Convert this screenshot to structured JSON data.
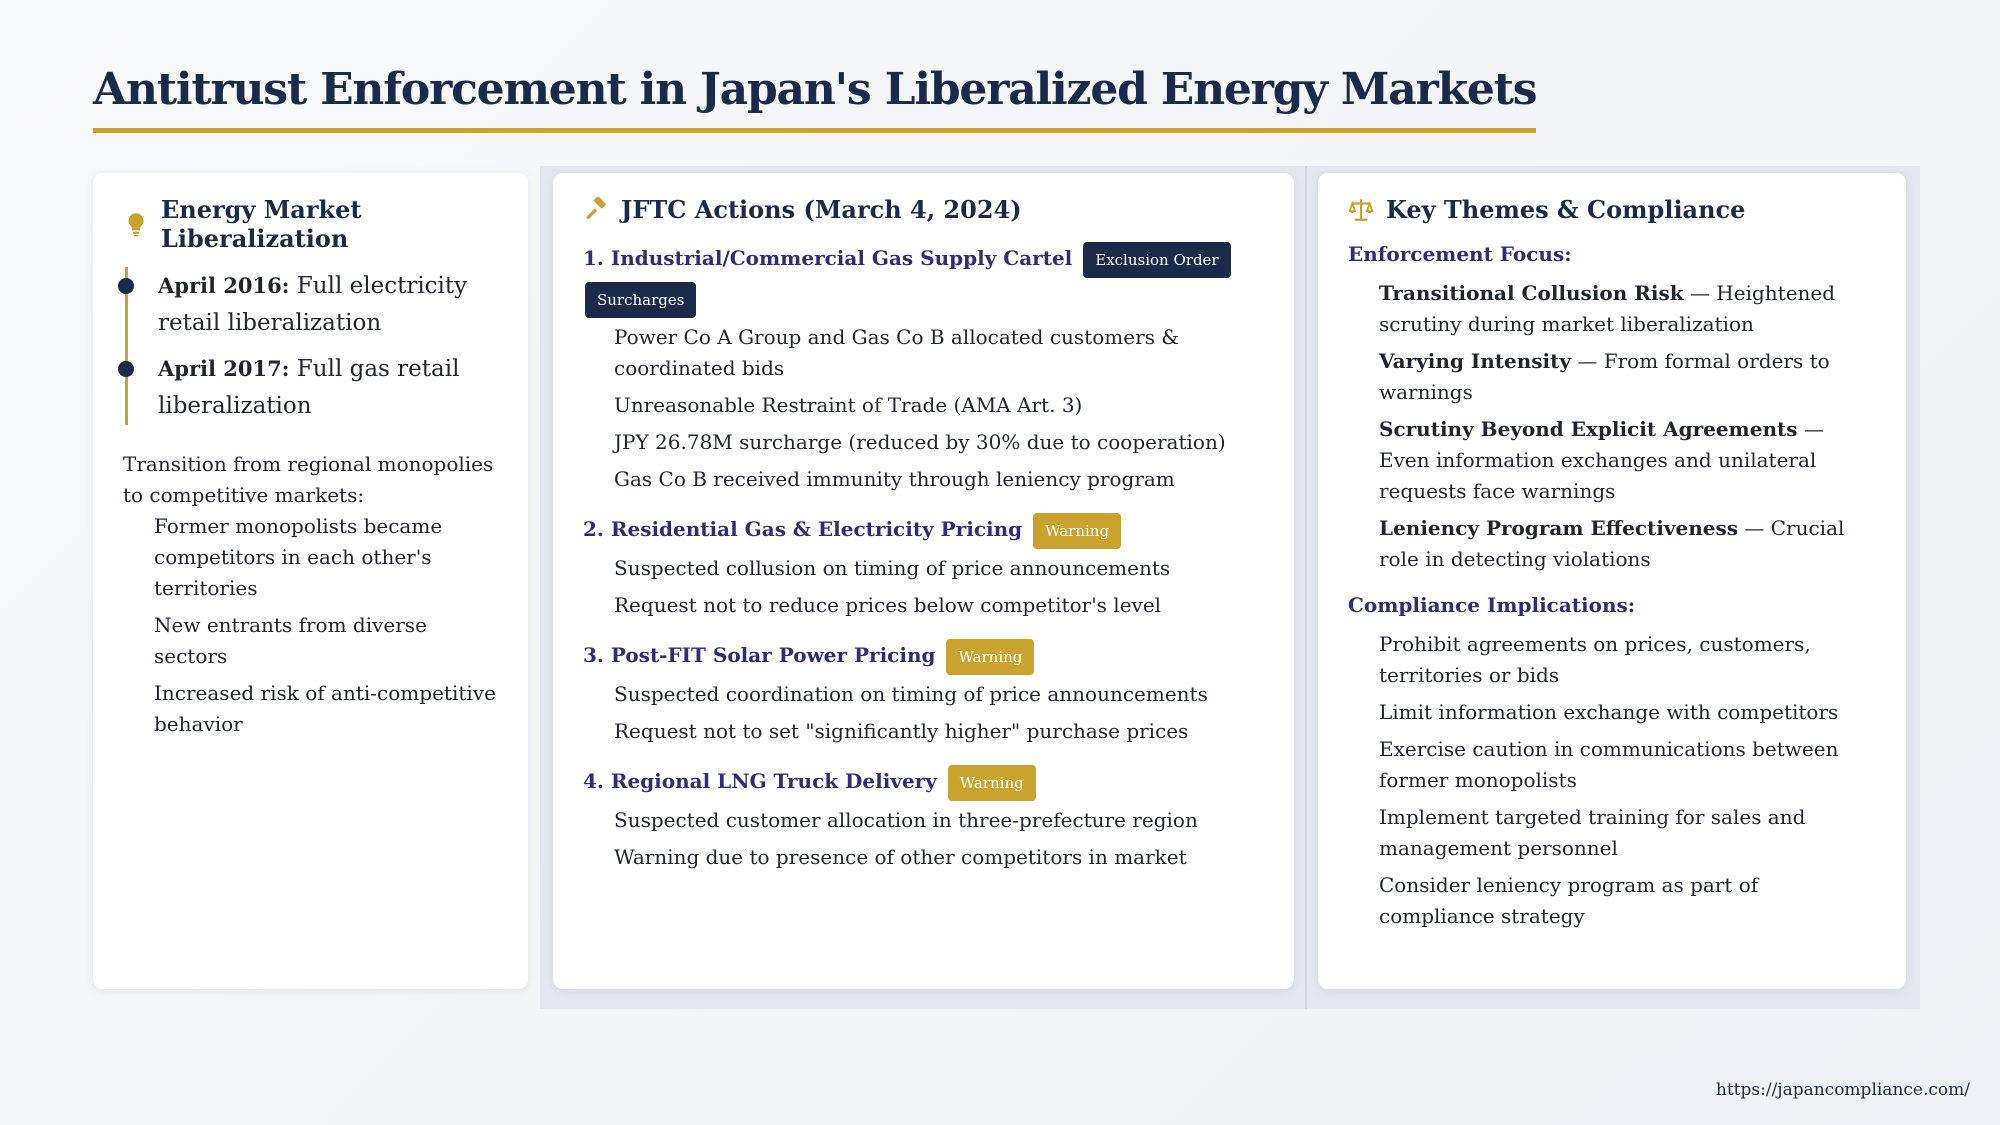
{
  "title": "Antitrust Enforcement in Japan's Liberalized Energy Markets",
  "colors": {
    "navy": "#1b2a4a",
    "gold": "#c9a32e",
    "purple": "#2e2d78"
  },
  "liberalization": {
    "icon": "lightbulb-icon",
    "heading": "Energy Market Liberalization",
    "timeline": [
      {
        "date": "April 2016:",
        "text": " Full electricity retail liberalization"
      },
      {
        "date": "April 2017:",
        "text": " Full gas retail liberalization"
      }
    ],
    "transition": "Transition from regional monopolies to competitive markets:",
    "points": [
      "Former monopolists became competitors in each other's territories",
      "New entrants from diverse sectors",
      "Increased risk of anti-competitive behavior"
    ]
  },
  "jftc": {
    "icon": "gavel-icon",
    "heading": "JFTC Actions (March 4, 2024)",
    "actions": [
      {
        "title": "1. Industrial/Commercial Gas Supply Cartel",
        "badges": [
          "Exclusion Order",
          "Surcharges"
        ],
        "points": [
          "Power Co A Group and Gas Co B allocated customers & coordinated bids",
          "Unreasonable Restraint of Trade (AMA Art. 3)",
          "JPY 26.78M surcharge (reduced by 30% due to cooperation)",
          "Gas Co B received immunity through leniency program"
        ]
      },
      {
        "title": "2. Residential Gas & Electricity Pricing",
        "badges": [
          "Warning"
        ],
        "points": [
          "Suspected collusion on timing of price announcements",
          "Request not to reduce prices below competitor's level"
        ]
      },
      {
        "title": "3. Post-FIT Solar Power Pricing",
        "badges": [
          "Warning"
        ],
        "points": [
          "Suspected coordination on timing of price announcements",
          "Request not to set \"significantly higher\" purchase prices"
        ]
      },
      {
        "title": "4. Regional LNG Truck Delivery",
        "badges": [
          "Warning"
        ],
        "points": [
          "Suspected customer allocation in three-prefecture region",
          "Warning due to presence of other competitors in market"
        ]
      }
    ]
  },
  "themes": {
    "icon": "scales-icon",
    "heading": "Key Themes & Compliance",
    "enforcement_title": "Enforcement Focus:",
    "enforcement": [
      {
        "term": "Transitional Collusion Risk",
        "desc": " — Heightened scrutiny during market liberalization"
      },
      {
        "term": "Varying Intensity",
        "desc": " — From formal orders to warnings"
      },
      {
        "term": "Scrutiny Beyond Explicit Agreements",
        "desc": " — Even information exchanges and unilateral requests face warnings"
      },
      {
        "term": "Leniency Program Effectiveness",
        "desc": " — Crucial role in detecting violations"
      }
    ],
    "compliance_title": "Compliance Implications:",
    "compliance": [
      "Prohibit agreements on prices, customers, territories or bids",
      "Limit information exchange with competitors",
      "Exercise caution in communications between former monopolists",
      "Implement targeted training for sales and management personnel",
      "Consider leniency program as part of compliance strategy"
    ]
  },
  "footer": {
    "url": "https://japancompliance.com/"
  }
}
